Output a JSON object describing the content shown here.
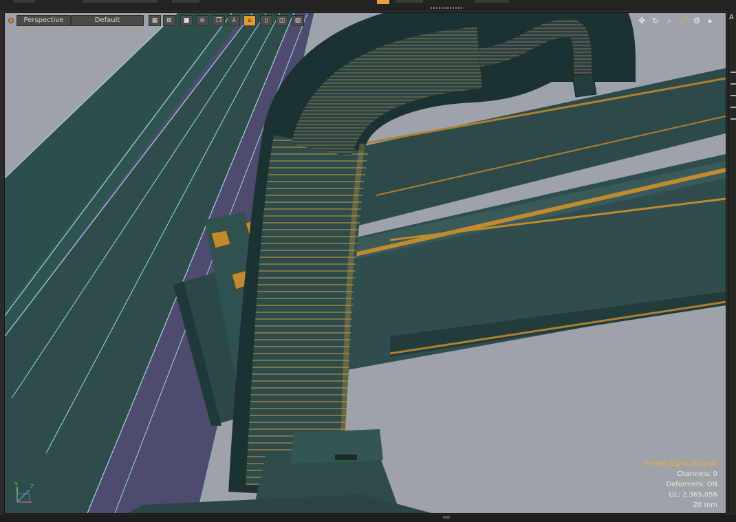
{
  "viewport": {
    "view_mode": "Perspective",
    "shading_style": "Default",
    "toolbar_icons": [
      "checker-grid-icon",
      "quad-grid-icon",
      "solid-square-icon",
      "wireframe-lines-icon",
      "duplicate-window-icon",
      "axes-triad-icon",
      "center-target-icon",
      "backface-icon",
      "bracket-icon",
      "striped-box-icon"
    ],
    "active_toolbar_icon": "center-target-icon",
    "nav_icons": [
      "move-view-icon",
      "rotate-view-icon",
      "zoom-view-icon",
      "fit-view-icon",
      "settings-gear-icon",
      "expand-arrow-icon"
    ],
    "info": {
      "title": "3-Point Lights Rotator",
      "channels": "Channels: 0",
      "deformers": "Deformers: ON",
      "gl": "GL: 2,365,056",
      "scale": "20 mm"
    },
    "gizmo": {
      "y_label": "Y",
      "z_label": "Z"
    }
  },
  "right_panel": {
    "cap": "A"
  },
  "colors": {
    "accent": "#f0b030",
    "viewport_bg": "#9da3a9",
    "beam_teal": "#2d4e4a",
    "beam_purple": "#4e4c6e",
    "edge_highlight": "#a8d4e0",
    "hose_gold": "#b08a3a"
  }
}
